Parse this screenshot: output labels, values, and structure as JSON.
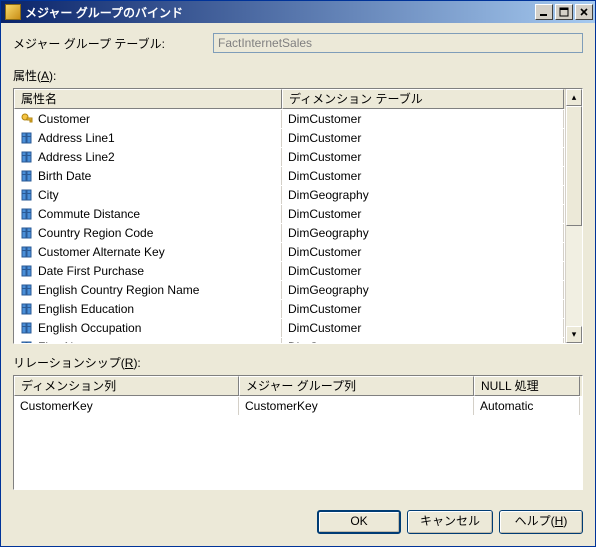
{
  "window": {
    "title": "メジャー グループのバインド"
  },
  "form": {
    "group_table_label": "メジャー グループ テーブル:",
    "group_table_value": "FactInternetSales"
  },
  "attributes": {
    "section_label_prefix": "属性(",
    "section_label_key": "A",
    "section_label_suffix": "):",
    "columns": {
      "name": "属性名",
      "dim_table": "ディメンション テーブル"
    },
    "rows": [
      {
        "name": "Customer",
        "dim": "DimCustomer",
        "key": true
      },
      {
        "name": "Address Line1",
        "dim": "DimCustomer",
        "key": false
      },
      {
        "name": "Address Line2",
        "dim": "DimCustomer",
        "key": false
      },
      {
        "name": "Birth Date",
        "dim": "DimCustomer",
        "key": false
      },
      {
        "name": "City",
        "dim": "DimGeography",
        "key": false
      },
      {
        "name": "Commute Distance",
        "dim": "DimCustomer",
        "key": false
      },
      {
        "name": "Country Region Code",
        "dim": "DimGeography",
        "key": false
      },
      {
        "name": "Customer Alternate Key",
        "dim": "DimCustomer",
        "key": false
      },
      {
        "name": "Date First Purchase",
        "dim": "DimCustomer",
        "key": false
      },
      {
        "name": "English Country Region Name",
        "dim": "DimGeography",
        "key": false
      },
      {
        "name": "English Education",
        "dim": "DimCustomer",
        "key": false
      },
      {
        "name": "English Occupation",
        "dim": "DimCustomer",
        "key": false
      },
      {
        "name": "First Name",
        "dim": "DimCustomer",
        "key": false
      }
    ]
  },
  "relationship": {
    "section_label_prefix": "リレーションシップ(",
    "section_label_key": "R",
    "section_label_suffix": "):",
    "columns": {
      "dim_col": "ディメンション列",
      "mg_col": "メジャー グループ列",
      "null_proc": "NULL 処理"
    },
    "rows": [
      {
        "dim_col": "CustomerKey",
        "mg_col": "CustomerKey",
        "null_proc": "Automatic"
      }
    ]
  },
  "buttons": {
    "ok": "OK",
    "cancel": "キャンセル",
    "help_prefix": "ヘルプ(",
    "help_key": "H",
    "help_suffix": ")"
  }
}
